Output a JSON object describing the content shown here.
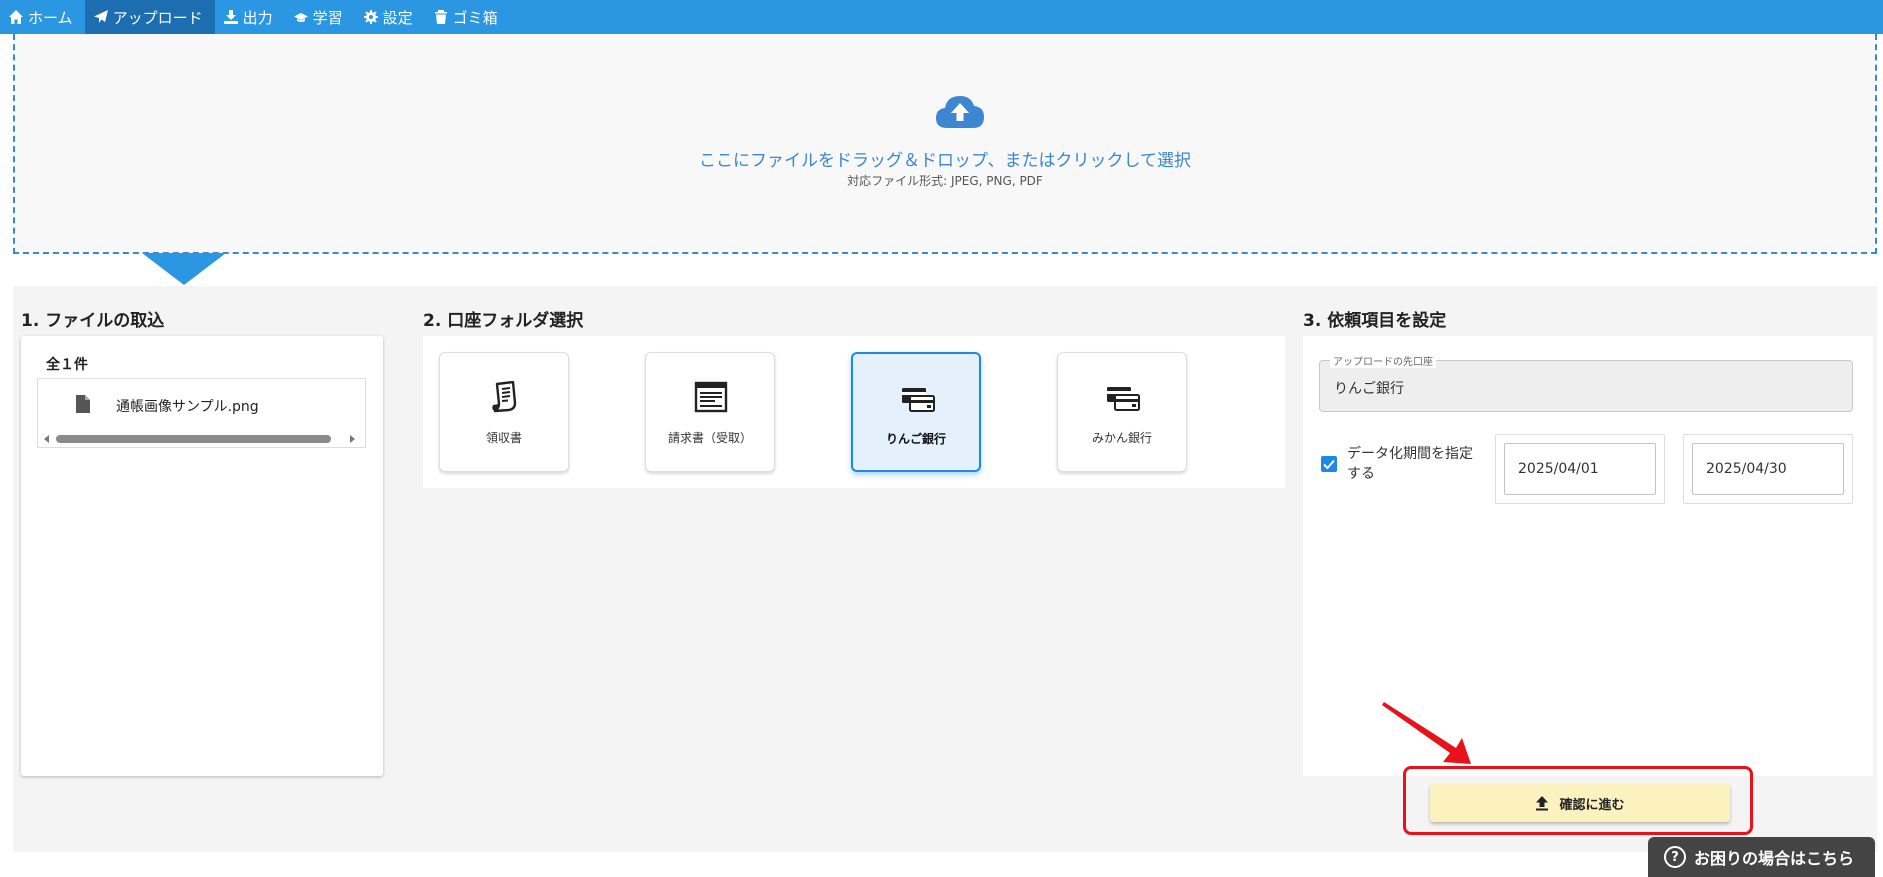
{
  "nav": {
    "items": [
      {
        "label": "ホーム",
        "icon": "home-icon"
      },
      {
        "label": "アップロード",
        "icon": "send-icon"
      },
      {
        "label": "出力",
        "icon": "download-icon"
      },
      {
        "label": "学習",
        "icon": "graduation-cap-icon"
      },
      {
        "label": "設定",
        "icon": "gear-icon"
      },
      {
        "label": "ゴミ箱",
        "icon": "trash-icon"
      }
    ],
    "active_index": 1
  },
  "dropzone": {
    "icon": "cloud-upload-icon",
    "main_text": "ここにファイルをドラッグ＆ドロップ、またはクリックして選択",
    "sub_text": "対応ファイル形式: JPEG, PNG, PDF"
  },
  "step1": {
    "title": "1. ファイルの取込",
    "count": "全１件",
    "files": [
      {
        "name": "通帳画像サンプル.png",
        "icon": "file-icon"
      }
    ]
  },
  "step2": {
    "title": "2. 口座フォルダ選択",
    "folders": [
      {
        "label": "領収書",
        "icon": "receipt-icon",
        "selected": false
      },
      {
        "label": "請求書（受取）",
        "icon": "invoice-icon",
        "selected": false
      },
      {
        "label": "りんご銀行",
        "icon": "bank-cards-icon",
        "selected": true
      },
      {
        "label": "みかん銀行",
        "icon": "bank-cards-icon",
        "selected": false
      }
    ]
  },
  "step3": {
    "title": "3. 依頼項目を設定",
    "account_label": "アップロードの先口座",
    "account_value": "りんご銀行",
    "period_label": "データ化期間を指定する",
    "period_checked": true,
    "date_from": "2025/04/01",
    "date_to": "2025/04/30"
  },
  "confirm_button": {
    "label": "確認に進む",
    "icon": "upload-icon"
  },
  "help": {
    "label": "お困りの場合はこちら",
    "icon": "question-icon"
  },
  "colors": {
    "nav_bg": "#2b96e1",
    "nav_active": "#1c6eb0",
    "accent": "#1e88e5",
    "confirm_bg": "#fbf2c0",
    "highlight_red": "#e8121a"
  }
}
